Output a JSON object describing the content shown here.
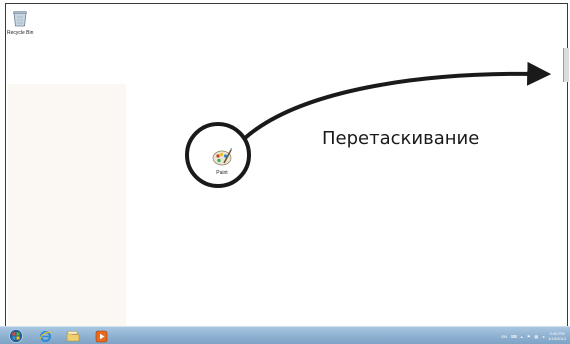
{
  "desktop": {
    "icons": {
      "recycle_bin": "Recycle Bin",
      "paint": "Paint"
    },
    "annotation_text": "Перетаскивание"
  },
  "taskbar": {
    "start_icon": "windows-orb-icon",
    "pinned": [
      "internet-explorer-icon",
      "folder-icon",
      "media-player-icon"
    ],
    "tray": {
      "language": "EN",
      "clock_time": "2:45 PM",
      "clock_date": "1/16/2014"
    }
  },
  "colors": {
    "taskbar": "#8eb1d1",
    "annotation": "#1a1a1a",
    "left_panel": "#fbf8f3"
  }
}
